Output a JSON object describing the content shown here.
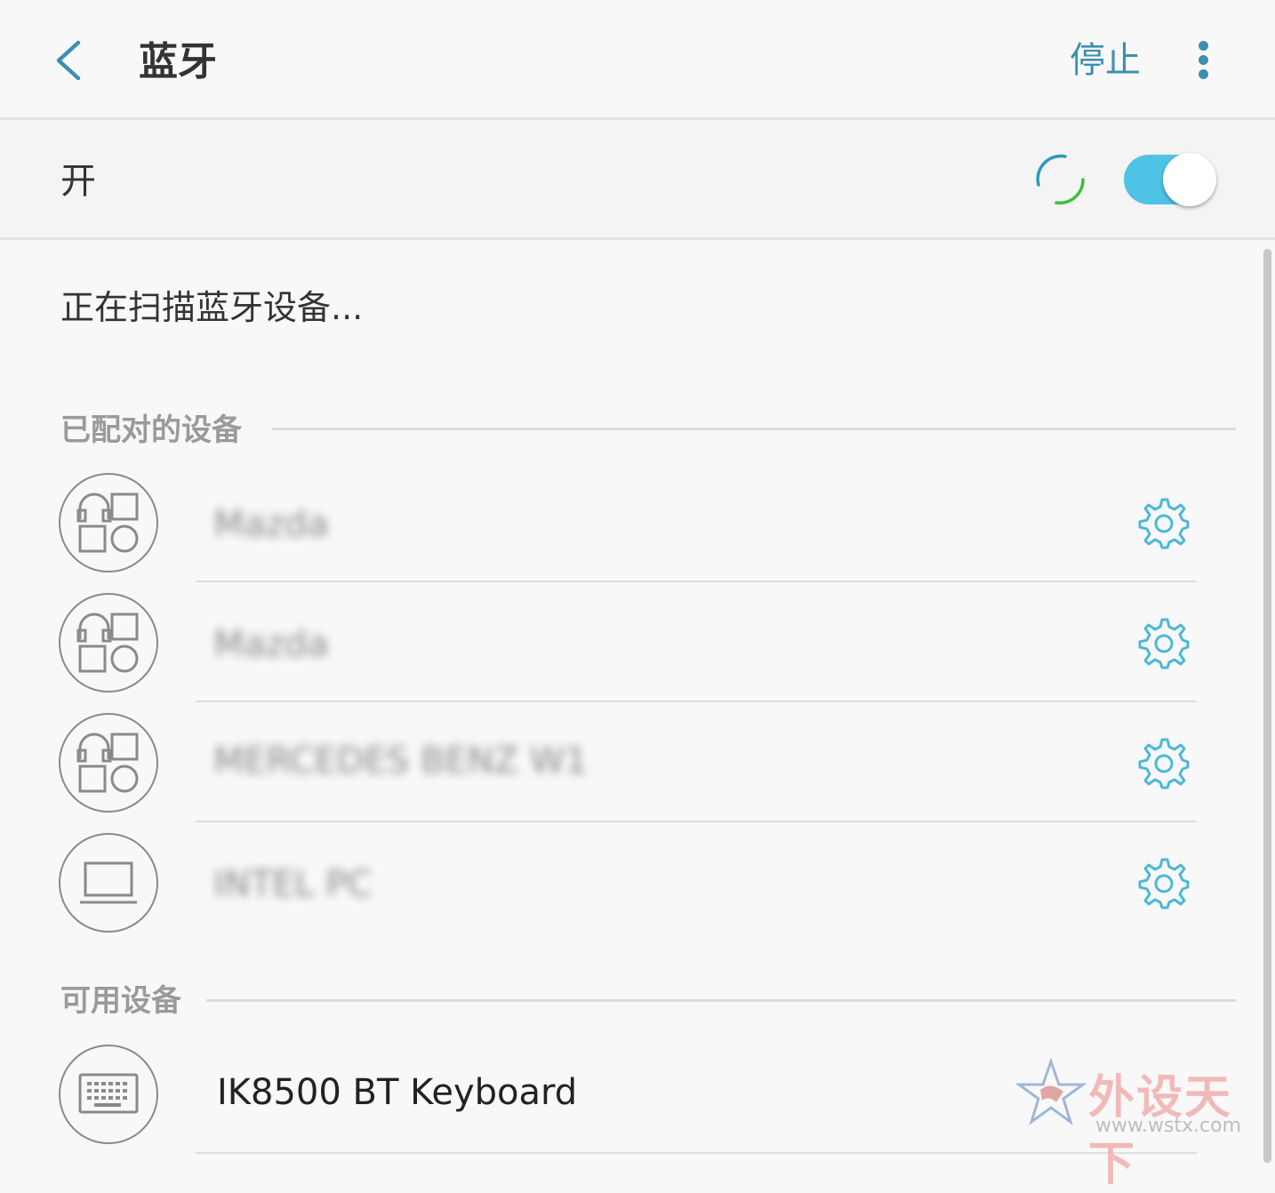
{
  "header": {
    "title": "蓝牙",
    "stop_label": "停止"
  },
  "master_switch": {
    "label": "开",
    "state": "on"
  },
  "status": {
    "scanning_text": "正在扫描蓝牙设备..."
  },
  "paired_section": {
    "title": "已配对的设备",
    "devices": [
      {
        "name": "Mazda",
        "icon": "multi-device-icon",
        "blurred": true
      },
      {
        "name": "Mazda",
        "icon": "multi-device-icon",
        "blurred": true
      },
      {
        "name": "MERCEDES BENZ W1",
        "icon": "multi-device-icon",
        "blurred": true
      },
      {
        "name": "INTEL PC",
        "icon": "laptop-icon",
        "blurred": true
      }
    ]
  },
  "available_section": {
    "title": "可用设备",
    "devices": [
      {
        "name": "IK8500 BT Keyboard",
        "icon": "keyboard-icon"
      }
    ]
  },
  "watermark": {
    "text": "外设天下",
    "url": "www.wstx.com"
  },
  "colors": {
    "accent": "#3d8fb0",
    "toggle_track": "#4ec3e6",
    "settings_icon": "#4ab8d8"
  }
}
